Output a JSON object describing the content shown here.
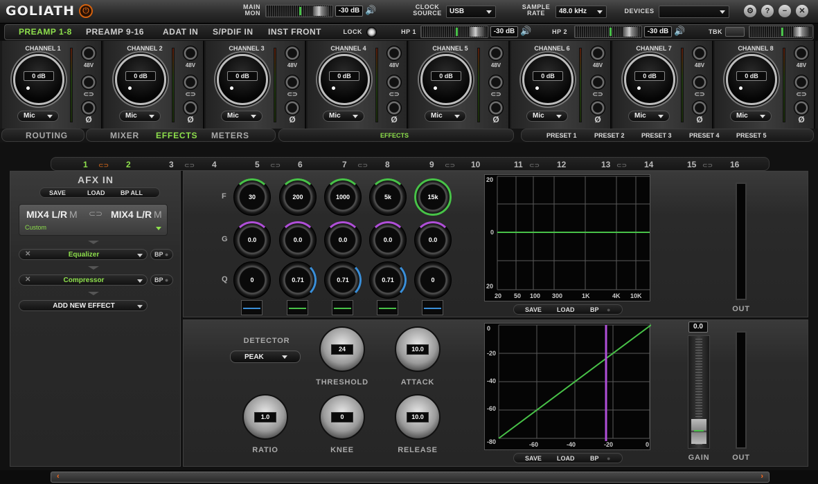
{
  "app": {
    "title": "GOLIATH"
  },
  "top": {
    "main_mon_label": "MAIN\nMON",
    "main_db": "-30 dB",
    "clock_label": "CLOCK\nSOURCE",
    "clock_value": "USB",
    "rate_label": "SAMPLE\nRATE",
    "rate_value": "48.0 kHz",
    "devices_label": "DEVICES",
    "devices_value": ""
  },
  "tabs": [
    "PREAMP 1-8",
    "PREAMP 9-16",
    "ADAT IN",
    "S/PDIF IN",
    "INST FRONT"
  ],
  "tabbar": {
    "lock": "LOCK",
    "hp1": "HP 1",
    "hp1_db": "-30 dB",
    "hp2": "HP 2",
    "hp2_db": "-30 dB",
    "tbk": "TBK"
  },
  "channels": [
    {
      "name": "CHANNEL 1",
      "gain": "0 dB",
      "input": "Mic"
    },
    {
      "name": "CHANNEL 2",
      "gain": "0 dB",
      "input": "Mic"
    },
    {
      "name": "CHANNEL 3",
      "gain": "0 dB",
      "input": "Mic"
    },
    {
      "name": "CHANNEL 4",
      "gain": "0 dB",
      "input": "Mic"
    },
    {
      "name": "CHANNEL 5",
      "gain": "0 dB",
      "input": "Mic"
    },
    {
      "name": "CHANNEL 6",
      "gain": "0 dB",
      "input": "Mic"
    },
    {
      "name": "CHANNEL 7",
      "gain": "0 dB",
      "input": "Mic"
    },
    {
      "name": "CHANNEL 8",
      "gain": "0 dB",
      "input": "Mic"
    }
  ],
  "ch_labels": {
    "phantom": "48V",
    "phase": "Ø"
  },
  "nav": [
    "ROUTING",
    "MIXER",
    "EFFECTS",
    "METERS"
  ],
  "nav_center": "EFFECTS",
  "presets": [
    "PRESET 1",
    "PRESET 2",
    "PRESET 3",
    "PRESET 4",
    "PRESET 5"
  ],
  "slots": [
    "1",
    "2",
    "3",
    "4",
    "5",
    "6",
    "7",
    "8",
    "9",
    "10",
    "11",
    "12",
    "13",
    "14",
    "15",
    "16"
  ],
  "afx": {
    "title": "AFX IN",
    "save": "SAVE",
    "load": "LOAD",
    "bp_all": "BP ALL",
    "source_left": "MIX4 L/R",
    "source_left_suffix": "M",
    "source_right": "MIX4 L/R",
    "source_right_suffix": "M",
    "preset": "Custom",
    "effects": [
      {
        "name": "Equalizer",
        "bp": "BP"
      },
      {
        "name": "Compressor",
        "bp": "BP"
      }
    ],
    "add_effect": "ADD NEW EFFECT"
  },
  "eq": {
    "row_labels": [
      "F",
      "G",
      "Q"
    ],
    "freq": [
      "30",
      "200",
      "1000",
      "5k",
      "15k"
    ],
    "gain": [
      "0.0",
      "0.0",
      "0.0",
      "0.0",
      "0.0"
    ],
    "q": [
      "0",
      "0.71",
      "0.71",
      "0.71",
      "0"
    ],
    "graph_y_top": "20",
    "graph_y_mid": "0",
    "graph_y_bot": "20",
    "graph_x": [
      "20",
      "50",
      "100",
      "300",
      "1K",
      "4K",
      "10K"
    ],
    "save": "SAVE",
    "load": "LOAD",
    "bp": "BP",
    "out": "OUT",
    "band_colors": [
      "#3a8fd9",
      "#48c248",
      "#48c248",
      "#48c248",
      "#3a8fd9"
    ]
  },
  "comp": {
    "detector_label": "DETECTOR",
    "detector": "PEAK",
    "threshold": "24",
    "threshold_label": "THRESHOLD",
    "attack": "10.0",
    "attack_label": "ATTACK",
    "ratio": "1.0",
    "ratio_label": "RATIO",
    "knee": "0",
    "knee_label": "KNEE",
    "release": "10.0",
    "release_label": "RELEASE",
    "graph_y": [
      "0",
      "-20",
      "-40",
      "-60",
      "-80"
    ],
    "graph_x": [
      "-60",
      "-40",
      "-20",
      "0"
    ],
    "save": "SAVE",
    "load": "LOAD",
    "bp": "BP",
    "gain_value": "0.0",
    "gain_label": "GAIN",
    "out": "OUT"
  },
  "colors": {
    "accent": "#8ee04c",
    "orange": "#d4620f",
    "purple": "#b04fd8"
  }
}
